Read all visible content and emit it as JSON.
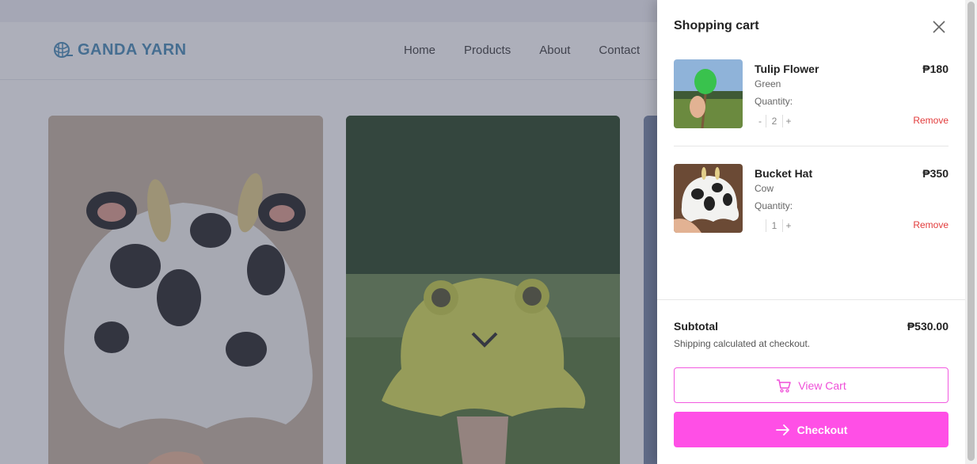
{
  "site": {
    "logo_text": "GANDA YARN",
    "nav": [
      "Home",
      "Products",
      "About",
      "Contact"
    ]
  },
  "cart": {
    "title": "Shopping cart",
    "items": [
      {
        "name": "Tulip Flower",
        "variant": "Green",
        "price": "₱180",
        "quantity_label": "Quantity:",
        "minus": "-",
        "quantity": "2",
        "plus": "+",
        "remove": "Remove"
      },
      {
        "name": "Bucket Hat",
        "variant": "Cow",
        "price": "₱350",
        "quantity_label": "Quantity:",
        "minus": "",
        "quantity": "1",
        "plus": "+",
        "remove": "Remove"
      }
    ],
    "subtotal_label": "Subtotal",
    "subtotal_value": "₱530.00",
    "shipping_note": "Shipping calculated at checkout.",
    "view_cart_label": "View Cart",
    "checkout_label": "Checkout"
  },
  "colors": {
    "accent": "#ff4fe6",
    "remove": "#e23b3b",
    "logo": "#4f8fb8"
  }
}
